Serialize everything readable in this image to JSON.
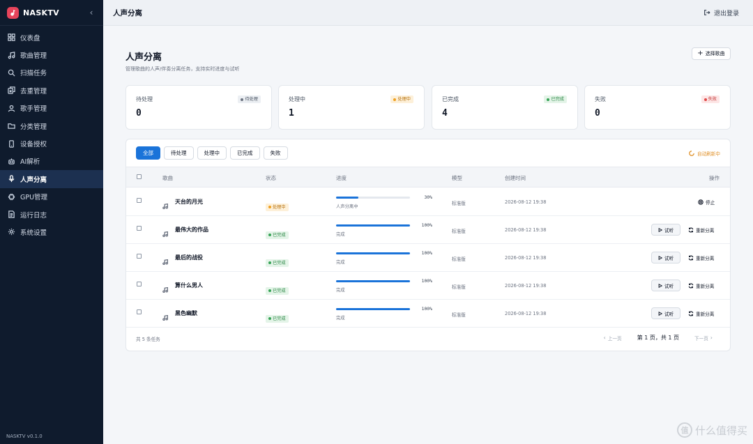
{
  "brand": {
    "name": "NASKTV",
    "version": "NASKTV v0.1.0"
  },
  "sidebar": {
    "items": [
      {
        "label": "仪表盘",
        "icon": "dashboard-icon"
      },
      {
        "label": "歌曲管理",
        "icon": "music-note-icon"
      },
      {
        "label": "扫描任务",
        "icon": "search-icon"
      },
      {
        "label": "去重管理",
        "icon": "dedupe-icon"
      },
      {
        "label": "歌手管理",
        "icon": "user-icon"
      },
      {
        "label": "分类管理",
        "icon": "folder-icon"
      },
      {
        "label": "设备授权",
        "icon": "device-icon"
      },
      {
        "label": "AI解析",
        "icon": "robot-icon"
      },
      {
        "label": "人声分离",
        "icon": "microphone-icon",
        "active": true
      },
      {
        "label": "GPU管理",
        "icon": "chip-icon"
      },
      {
        "label": "运行日志",
        "icon": "log-icon"
      },
      {
        "label": "系统设置",
        "icon": "gear-icon"
      }
    ]
  },
  "header": {
    "title": "人声分离",
    "logout": "退出登录"
  },
  "page": {
    "title": "人声分离",
    "description": "管理歌曲的人声/伴奏分离任务，支持实时进度与试听",
    "select_button": "选择歌曲"
  },
  "stats": [
    {
      "label": "待处理",
      "value": "0",
      "badge": "待处理",
      "kind": "wait"
    },
    {
      "label": "处理中",
      "value": "1",
      "badge": "处理中",
      "kind": "proc"
    },
    {
      "label": "已完成",
      "value": "4",
      "badge": "已完成",
      "kind": "done"
    },
    {
      "label": "失败",
      "value": "0",
      "badge": "失败",
      "kind": "fail"
    }
  ],
  "tabs": [
    "全部",
    "待处理",
    "处理中",
    "已完成",
    "失败"
  ],
  "auto_refresh": "自动刷新中",
  "table": {
    "columns": [
      "歌曲",
      "状态",
      "进度",
      "模型",
      "创建时间",
      "操作"
    ],
    "rows": [
      {
        "song": "天台的月光",
        "status": "处理中",
        "kind": "proc",
        "progress": 30,
        "progress_label": "30%",
        "progress_text": "人声分离中",
        "model": "标准版",
        "created": "2026-08-12 19:38",
        "actions": {
          "stop": "停止"
        }
      },
      {
        "song": "最伟大的作品",
        "status": "已完成",
        "kind": "done",
        "progress": 100,
        "progress_label": "100%",
        "progress_text": "完成",
        "model": "标准版",
        "created": "2026-08-12 19:38",
        "actions": {
          "listen": "试听",
          "resep": "重新分离"
        }
      },
      {
        "song": "最后的战役",
        "status": "已完成",
        "kind": "done",
        "progress": 100,
        "progress_label": "100%",
        "progress_text": "完成",
        "model": "标准版",
        "created": "2026-08-12 19:38",
        "actions": {
          "listen": "试听",
          "resep": "重新分离"
        }
      },
      {
        "song": "算什么男人",
        "status": "已完成",
        "kind": "done",
        "progress": 100,
        "progress_label": "100%",
        "progress_text": "完成",
        "model": "标准版",
        "created": "2026-08-12 19:38",
        "actions": {
          "listen": "试听",
          "resep": "重新分离"
        }
      },
      {
        "song": "黑色幽默",
        "status": "已完成",
        "kind": "done",
        "progress": 100,
        "progress_label": "100%",
        "progress_text": "完成",
        "model": "标准版",
        "created": "2026-08-12 19:38",
        "actions": {
          "listen": "试听",
          "resep": "重新分离"
        }
      }
    ]
  },
  "footer": {
    "total": "共 5 条任务",
    "prev": "上一页",
    "current": "第 1 页，共 1 页",
    "next": "下一页"
  },
  "watermark": {
    "text": "什么值得买",
    "logo_char": "值"
  },
  "colors": {
    "sidebar_bg": "#0f1b2d",
    "accent": "#1a73d9",
    "processing": "#f0a020",
    "done": "#37a356",
    "fail": "#e04848"
  }
}
